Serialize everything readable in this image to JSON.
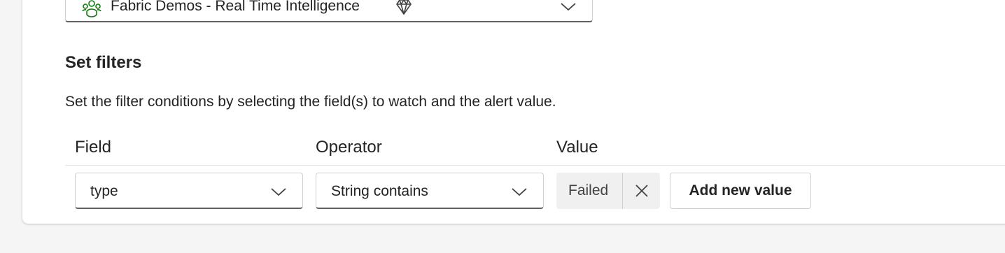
{
  "workspace": {
    "name": "Fabric Demos - Real Time Intelligence",
    "icon": "workspace-people-icon",
    "badge_icon": "premium-diamond-icon"
  },
  "filters": {
    "title": "Set filters",
    "description": "Set the filter conditions by selecting the field(s) to watch and the alert value.",
    "columns": {
      "field": "Field",
      "operator": "Operator",
      "value": "Value"
    },
    "row": {
      "field_value": "type",
      "operator_value": "String contains",
      "value_tags": [
        "Failed"
      ],
      "add_value_label": "Add new value"
    }
  },
  "colors": {
    "background": "#f5f5f5",
    "panel": "#ffffff",
    "text": "#242424",
    "tag_background": "#f0f0f0",
    "border": "#d1d1d1",
    "underline": "#616161"
  }
}
